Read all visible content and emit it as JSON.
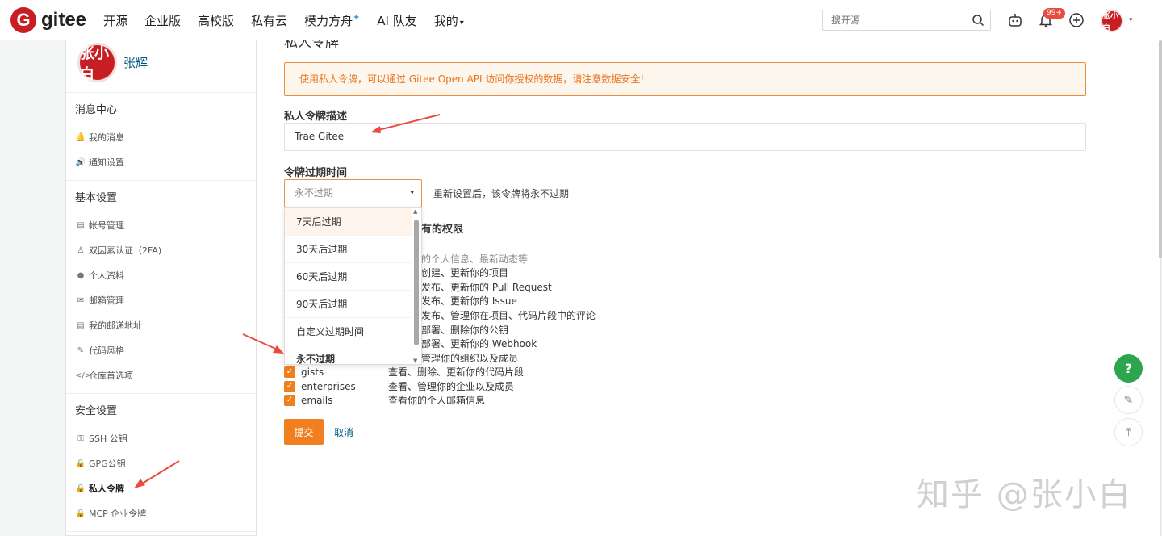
{
  "brand": {
    "logo_letter": "G",
    "name": "gitee",
    "color": "#c71d23"
  },
  "nav": {
    "items": [
      "开源",
      "企业版",
      "高校版",
      "私有云",
      "模力方舟",
      "AI 队友",
      "我的"
    ],
    "star": "✦",
    "my_caret": "▾"
  },
  "search": {
    "placeholder": "搜开源"
  },
  "notifications": {
    "badge": "99+"
  },
  "user": {
    "avatar_text": "张小白",
    "name": "张辉",
    "caret": "▾"
  },
  "sidebar": {
    "sections": [
      {
        "title": "消息中心",
        "items": [
          {
            "icon": "bell-icon",
            "glyph": "🔔",
            "label": "我的消息"
          },
          {
            "icon": "speaker-icon",
            "glyph": "🔊",
            "label": "通知设置"
          }
        ]
      },
      {
        "title": "基本设置",
        "items": [
          {
            "icon": "id-card-icon",
            "glyph": "▤",
            "label": "帐号管理"
          },
          {
            "icon": "user-shield-icon",
            "glyph": "♙",
            "label": "双因素认证（2FA)"
          },
          {
            "icon": "user-icon",
            "glyph": "●",
            "label": "个人资料"
          },
          {
            "icon": "mail-icon",
            "glyph": "✉",
            "label": "邮箱管理"
          },
          {
            "icon": "address-card-icon",
            "glyph": "▤",
            "label": "我的邮递地址"
          },
          {
            "icon": "brush-icon",
            "glyph": "✎",
            "label": "代码风格"
          },
          {
            "icon": "code-icon",
            "glyph": "</>",
            "label": "仓库首选项"
          }
        ]
      },
      {
        "title": "安全设置",
        "items": [
          {
            "icon": "key-icon",
            "glyph": "⚿",
            "label": "SSH 公钥"
          },
          {
            "icon": "lock-icon",
            "glyph": "🔒",
            "label": "GPG公钥"
          },
          {
            "icon": "lock-icon",
            "glyph": "🔒",
            "label": "私人令牌",
            "active": true
          },
          {
            "icon": "lock-icon",
            "glyph": "🔒",
            "label": "MCP 企业令牌"
          }
        ]
      }
    ]
  },
  "main": {
    "page_title": "私人令牌",
    "notice": "使用私人令牌，可以通过 Gitee Open API 访问你授权的数据，请注意数据安全!",
    "desc_label": "私人令牌描述",
    "desc_value": "Trae Gitee",
    "expire_label": "令牌过期时间",
    "expire_selected": "永不过期",
    "expire_caret": "▾",
    "expire_tip": "重新设置后，该令牌将永不过期",
    "expire_options": [
      "7天后过期",
      "30天后过期",
      "60天后过期",
      "90天后过期",
      "自定义过期时间",
      "永不过期"
    ],
    "permission_header_partial": "有的权限",
    "partial_descs": [
      "的个人信息、最新动态等",
      "创建、更新你的项目",
      "发布、更新你的 Pull Request",
      "发布、更新你的 Issue",
      "发布、管理你在项目、代码片段中的评论",
      "部署、删除你的公钥",
      "部署、更新你的 Webhook",
      "管理你的组织以及成员"
    ],
    "permissions": [
      {
        "name": "gists",
        "desc": "查看、删除、更新你的代码片段",
        "checked": true
      },
      {
        "name": "enterprises",
        "desc": "查看、管理你的企业以及成员",
        "checked": true
      },
      {
        "name": "emails",
        "desc": "查看你的个人邮箱信息",
        "checked": true
      }
    ],
    "checkmark": "✓",
    "submit_label": "提交",
    "cancel_label": "取消"
  },
  "floating": {
    "help": "?",
    "feedback": "✎",
    "top": "⤒"
  },
  "watermark": "知乎 @张小白",
  "colors": {
    "accent": "#f0801f",
    "link": "#005980",
    "notice_bg": "#fdf6ec",
    "help_green": "#2da44e",
    "arrow_red": "#e84c3d"
  }
}
